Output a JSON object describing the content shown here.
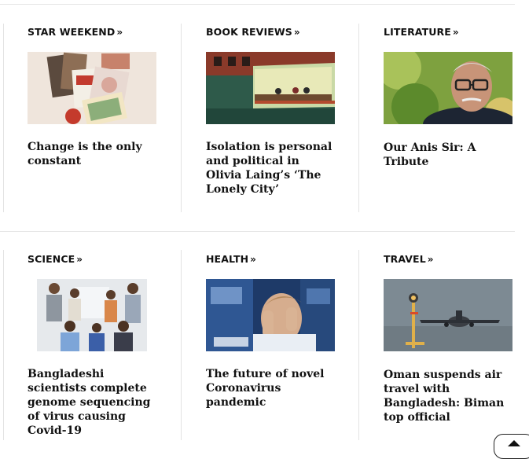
{
  "sections": [
    {
      "category": "STAR WEEKEND",
      "headline": "Change is the only constant",
      "image_subject": "magazine-covers"
    },
    {
      "category": "BOOK REVIEWS",
      "headline": "Isolation is personal and political in Olivia Laing’s ‘The Lonely City’",
      "image_subject": "night-diner-painting"
    },
    {
      "category": "LITERATURE",
      "headline": "Our Anis Sir: A Tribute",
      "image_subject": "portrait-man-glasses"
    },
    {
      "category": "SCIENCE",
      "headline": "Bangladeshi scientists complete genome sequencing of virus causing Covid-19",
      "image_subject": "scientists-group-photo"
    },
    {
      "category": "HEALTH",
      "headline": "The future of novel Coronavirus pandemic",
      "image_subject": "stressed-trader"
    },
    {
      "category": "TRAVEL",
      "headline": "Oman suspends air travel with Bangladesh: Biman top official",
      "image_subject": "airplane-landing"
    }
  ],
  "chevron_glyph": "»",
  "icons": {
    "category_chevron": "double-chevron-right-icon",
    "back_to_top": "chevron-up-icon"
  }
}
